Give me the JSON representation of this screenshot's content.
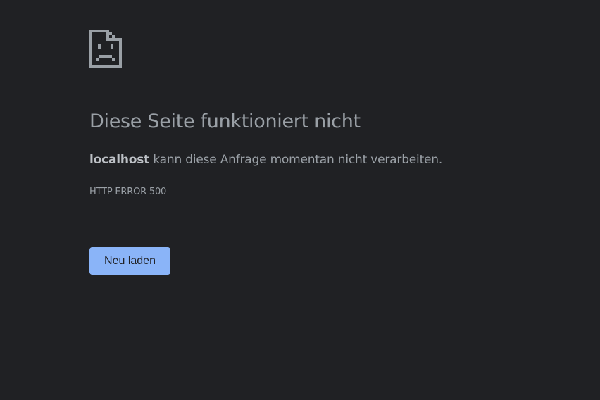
{
  "error_page": {
    "icon": "sad-page-icon",
    "heading": "Diese Seite funktioniert nicht",
    "message": {
      "host": "localhost",
      "text": " kann diese Anfrage momentan nicht verarbeiten."
    },
    "error_code": "HTTP ERROR 500",
    "reload_button_label": "Neu laden"
  },
  "colors": {
    "background": "#202124",
    "text": "#9aa0a6",
    "emphasis": "#bdc1c6",
    "button": "#8ab4f8",
    "button_text": "#202124"
  }
}
